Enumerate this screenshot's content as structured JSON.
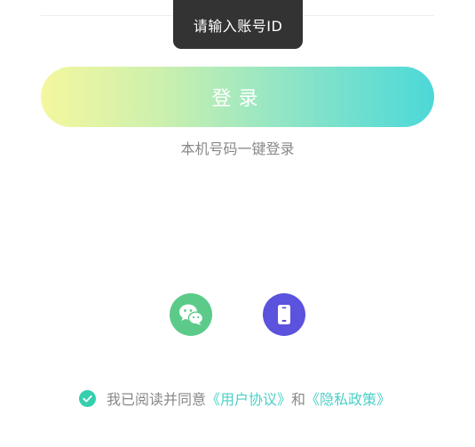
{
  "toast": {
    "message": "请输入账号ID"
  },
  "login": {
    "button_label": "登录",
    "quick_login_label": "本机号码一键登录"
  },
  "agreement": {
    "prefix": "我已阅读并同意",
    "user_agreement": "《用户协议》",
    "conjunction": "和",
    "privacy_policy": "《隐私政策》"
  },
  "icons": {
    "wechat": "wechat-icon",
    "phone": "phone-icon",
    "check": "check-circle-icon"
  },
  "colors": {
    "wechat_green": "#5ccb8a",
    "phone_purple": "#5b52dd",
    "accent_teal": "#4ccfc7",
    "check_green": "#35cfae",
    "gradient_start": "#f4f79e",
    "gradient_end": "#4cd8d8"
  }
}
